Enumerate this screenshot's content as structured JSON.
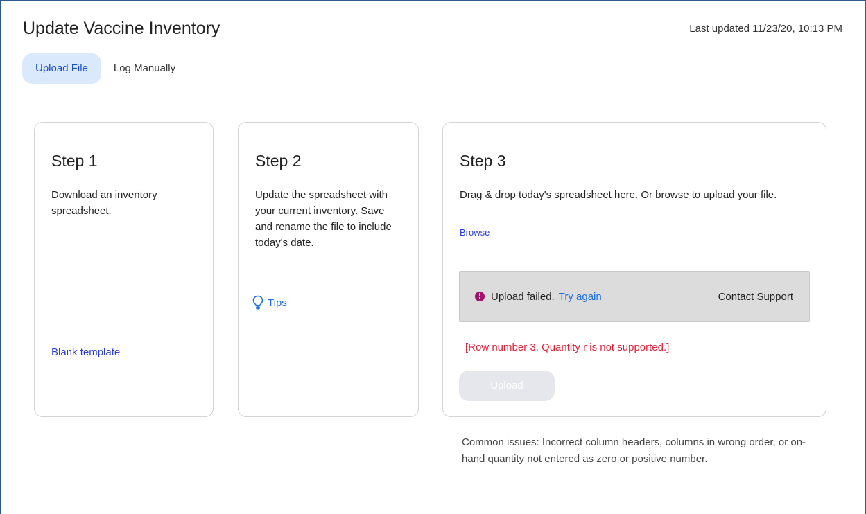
{
  "page": {
    "title": "Update Vaccine Inventory",
    "last_updated": "Last updated 11/23/20, 10:13 PM"
  },
  "tabs": [
    {
      "label": "Upload File",
      "active": true
    },
    {
      "label": "Log Manually",
      "active": false
    }
  ],
  "step1": {
    "title": "Step 1",
    "description": "Download an inventory spreadsheet.",
    "link": "Blank template"
  },
  "step2": {
    "title": "Step 2",
    "description": "Update the spreadsheet with your current inventory. Save and rename the file to include today's date.",
    "tips_label": "Tips",
    "tips_icon": "lightbulb-icon"
  },
  "step3": {
    "title": "Step 3",
    "description": "Drag & drop today's spreadsheet here. Or browse to upload your file.",
    "browse_label": "Browse",
    "alert": {
      "icon": "error-icon",
      "message": "Upload failed.",
      "try_again": "Try again",
      "contact_support": "Contact Support"
    },
    "error_detail": "[Row number 3. Quantity r is not supported.]",
    "upload_button": "Upload"
  },
  "common_issues": "Common issues: Incorrect column headers, columns in wrong order, or on-hand quantity not entered as zero or positive number.",
  "colors": {
    "accent": "#1f6fe0",
    "active_tab_bg": "#dbe9fd",
    "error_text": "#e0223a",
    "error_icon": "#a3136b",
    "alert_bg": "#dcdcdc"
  }
}
